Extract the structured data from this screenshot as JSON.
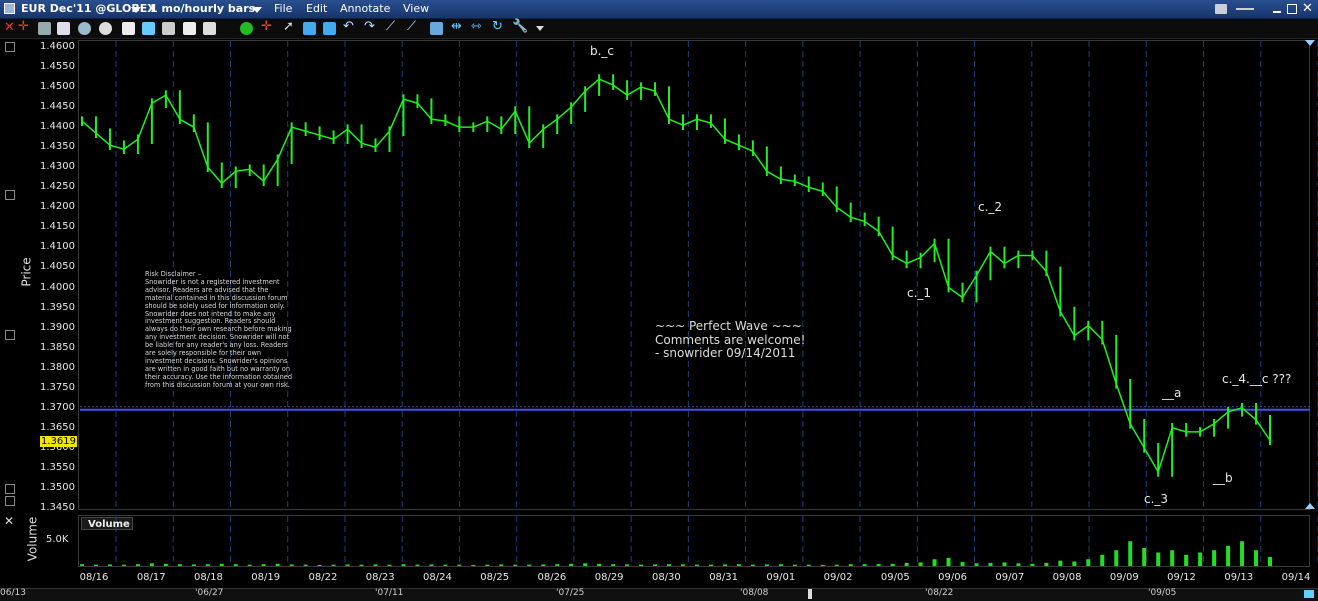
{
  "window": {
    "symbol": "EUR Dec'11 @GLOBEX",
    "period": "1 mo/hourly bars",
    "menu": [
      "File",
      "Edit",
      "Annotate",
      "View"
    ]
  },
  "axis": {
    "price_label": "Price",
    "volume_label": "Volume",
    "volume_tick": "5.0K",
    "price_ticks": [
      "1.4600",
      "1.4550",
      "1.4500",
      "1.4450",
      "1.4400",
      "1.4350",
      "1.4300",
      "1.4250",
      "1.4200",
      "1.4150",
      "1.4100",
      "1.4050",
      "1.4000",
      "1.3950",
      "1.3900",
      "1.3850",
      "1.3800",
      "1.3750",
      "1.3700",
      "1.3650",
      "1.3600",
      "1.3550",
      "1.3500",
      "1.3450"
    ],
    "last_price": "1.3619",
    "date_ticks": [
      "08/16",
      "08/17",
      "08/18",
      "08/19",
      "08/22",
      "08/23",
      "08/24",
      "08/25",
      "08/26",
      "08/29",
      "08/30",
      "08/31",
      "09/01",
      "09/02",
      "09/05",
      "09/06",
      "09/07",
      "09/08",
      "09/09",
      "09/12",
      "09/13",
      "09/14"
    ],
    "overview_ticks": [
      "06/13",
      "'06/27",
      "'07/11",
      "'07/25",
      "'08/08",
      "'08/22",
      "'09/05"
    ]
  },
  "legend": {
    "volume_tab": "Volume"
  },
  "colors": {
    "price_line": "#22ee22",
    "volume_bars": "#22dd22",
    "horizontal_line": "#4a4ef0",
    "grid": "#1d3f7a",
    "last_price_bg": "#f2e600"
  },
  "annotations": {
    "bc": "b._c",
    "c2": "c._2",
    "c1": "c._1",
    "a": "__a",
    "c4": "c._4.__c ???",
    "b": "__b",
    "c3": "c._3"
  },
  "note": {
    "lines": [
      "~~~ Perfect Wave ~~~",
      "Comments are welcome!",
      "- snowrider  09/14/2011"
    ]
  },
  "disclaimer": {
    "lines": [
      "Risk Disclaimer –",
      "Snowrider is not a registered investment",
      "advisor.  Readers are advised that the",
      "material contained in this discussion forum",
      "should be solely used for information only.",
      "Snowrider does not intend to make any",
      "investment suggestion.  Readers should",
      "always do their own research before making",
      "any investment decision.  Snowrider will not",
      "be liable for any reader's any loss.  Readers",
      "are solely responsible for their own",
      "investment decisions.  Snowrider's opinions",
      "are written in good faith but no warranty on",
      "their accuracy.  Use the information obtained",
      "from this discussion forum  at your own risk."
    ]
  },
  "chart_data": {
    "type": "line",
    "title": "EUR Dec'11 @GLOBEX",
    "xlabel": "",
    "ylabel": "Price",
    "ylim": [
      1.345,
      1.4625
    ],
    "horizontal_line": 1.3695,
    "grid": true,
    "series": [
      {
        "name": "",
        "x": [
          "08/16",
          "08/16",
          "08/16",
          "08/16",
          "08/17",
          "08/17",
          "08/17",
          "08/17",
          "08/18",
          "08/18",
          "08/18",
          "08/18",
          "08/19",
          "08/19",
          "08/19",
          "08/19",
          "08/22",
          "08/22",
          "08/22",
          "08/22",
          "08/23",
          "08/23",
          "08/23",
          "08/23",
          "08/24",
          "08/24",
          "08/24",
          "08/24",
          "08/25",
          "08/25",
          "08/25",
          "08/25",
          "08/26",
          "08/26",
          "08/26",
          "08/26",
          "08/29",
          "08/29",
          "08/29",
          "08/29",
          "08/30",
          "08/30",
          "08/30",
          "08/30",
          "08/31",
          "08/31",
          "08/31",
          "08/31",
          "09/01",
          "09/01",
          "09/01",
          "09/01",
          "09/02",
          "09/02",
          "09/02",
          "09/02",
          "09/05",
          "09/05",
          "09/05",
          "09/05",
          "09/06",
          "09/06",
          "09/06",
          "09/06",
          "09/07",
          "09/07",
          "09/07",
          "09/07",
          "09/08",
          "09/08",
          "09/08",
          "09/08",
          "09/09",
          "09/09",
          "09/09",
          "09/09",
          "09/12",
          "09/12",
          "09/12",
          "09/12",
          "09/13",
          "09/13",
          "09/13",
          "09/13",
          "09/14",
          "09/14"
        ],
        "close": [
          1.4415,
          1.4385,
          1.4355,
          1.4345,
          1.437,
          1.446,
          1.448,
          1.442,
          1.44,
          1.43,
          1.426,
          1.429,
          1.4295,
          1.4265,
          1.432,
          1.44,
          1.439,
          1.438,
          1.437,
          1.4395,
          1.436,
          1.435,
          1.439,
          1.447,
          1.446,
          1.442,
          1.4415,
          1.44,
          1.44,
          1.4415,
          1.4395,
          1.444,
          1.436,
          1.4395,
          1.442,
          1.445,
          1.449,
          1.452,
          1.4505,
          1.448,
          1.45,
          1.449,
          1.442,
          1.4405,
          1.442,
          1.441,
          1.437,
          1.4355,
          1.434,
          1.429,
          1.427,
          1.4265,
          1.425,
          1.424,
          1.42,
          1.4175,
          1.4165,
          1.414,
          1.408,
          1.406,
          1.4075,
          1.411,
          1.4,
          1.3975,
          1.403,
          1.409,
          1.406,
          1.408,
          1.408,
          1.404,
          1.394,
          1.388,
          1.3905,
          1.387,
          1.376,
          1.366,
          1.36,
          1.354,
          1.365,
          1.364,
          1.364,
          1.366,
          1.369,
          1.37,
          1.367,
          1.3619
        ]
      }
    ],
    "volume": {
      "ylim": [
        0,
        8000
      ],
      "values": [
        400,
        300,
        350,
        300,
        400,
        600,
        500,
        400,
        350,
        400,
        500,
        400,
        300,
        400,
        500,
        350,
        300,
        250,
        300,
        350,
        300,
        350,
        300,
        400,
        300,
        350,
        300,
        300,
        250,
        300,
        350,
        300,
        300,
        350,
        400,
        500,
        600,
        500,
        400,
        350,
        300,
        350,
        400,
        350,
        300,
        300,
        350,
        400,
        300,
        350,
        400,
        300,
        300,
        250,
        300,
        400,
        400,
        450,
        500,
        700,
        800,
        1500,
        1800,
        900,
        600,
        700,
        800,
        600,
        500,
        700,
        1200,
        1000,
        1500,
        2500,
        3500,
        5500,
        4000,
        3000,
        3500,
        2500,
        3000,
        3500,
        4500,
        5500,
        3500,
        2000
      ]
    }
  }
}
